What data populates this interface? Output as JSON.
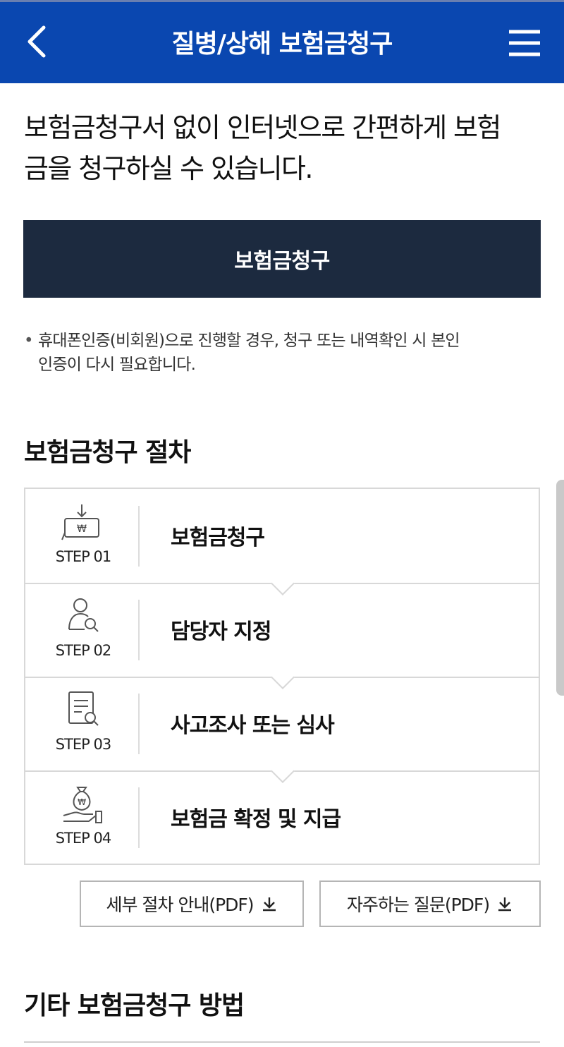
{
  "header": {
    "title": "질병/상해 보험금청구",
    "back_icon": "chevron-left-icon",
    "menu_icon": "hamburger-menu-icon",
    "background": "#0a47b0"
  },
  "intro": {
    "line1": "보험금청구서 없이 인터넷으로 간편하게 보험",
    "line2": "금을 청구하실 수 있습니다."
  },
  "claim_button": {
    "label": "보험금청구",
    "background": "#1c2a3f"
  },
  "note": {
    "bullet": "•",
    "line1": "휴대폰인증(비회원)으로 진행할 경우, 청구 또는 내역확인 시 본인",
    "line2": "인증이 다시 필요합니다."
  },
  "procedure": {
    "title": "보험금청구 절차",
    "steps": [
      {
        "num": "STEP 01",
        "label": "보험금청구",
        "icon": "won-document-icon"
      },
      {
        "num": "STEP 02",
        "label": "담당자 지정",
        "icon": "person-search-icon"
      },
      {
        "num": "STEP 03",
        "label": "사고조사 또는 심사",
        "icon": "document-search-icon"
      },
      {
        "num": "STEP 04",
        "label": "보험금 확정 및 지급",
        "icon": "money-bag-hand-icon"
      }
    ]
  },
  "downloads": {
    "detail_guide": "세부 절차 안내(PDF)",
    "faq": "자주하는 질문(PDF)",
    "icon": "download-icon"
  },
  "other_methods": {
    "title": "기타 보험금청구 방법"
  }
}
